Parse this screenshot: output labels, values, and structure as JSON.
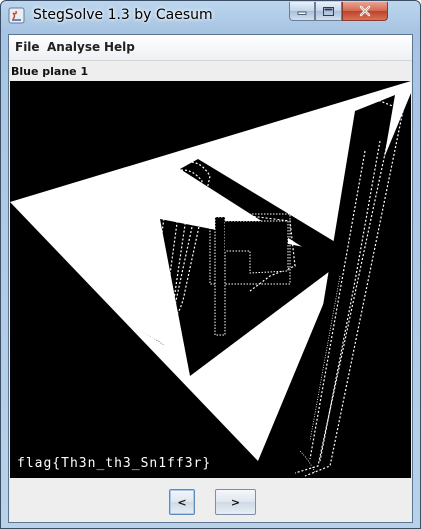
{
  "window": {
    "title": "StegSolve 1.3 by Caesum"
  },
  "menu": {
    "items": [
      "File",
      "Analyse",
      "Help"
    ]
  },
  "view": {
    "plane_label": "Blue plane 1",
    "hidden_text": "flag{Th3n_th3_Sn1ff3r}"
  },
  "navigation": {
    "prev_label": "<",
    "next_label": ">"
  },
  "colors": {
    "title_bar": "#a7c4e2",
    "close_button": "#c0412a",
    "image_background": "#000000",
    "image_foreground": "#ffffff"
  }
}
